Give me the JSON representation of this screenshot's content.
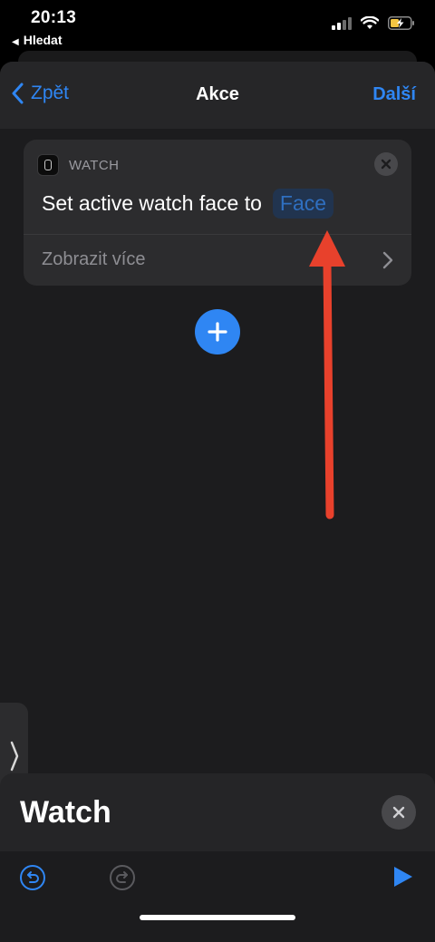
{
  "status": {
    "time": "20:13",
    "back_app": "Hledat"
  },
  "nav": {
    "back_label": "Zpět",
    "title": "Akce",
    "next_label": "Další"
  },
  "card": {
    "app_name": "WATCH",
    "action_text": "Set active watch face to",
    "parameter": "Face",
    "show_more": "Zobrazit více"
  },
  "panel": {
    "title": "Watch"
  },
  "colors": {
    "accent": "#2f86f3",
    "annotation_arrow": "#e8412c",
    "background": "#1c1c1e"
  },
  "icons": [
    "signal-icon",
    "wifi-icon",
    "battery-charging-icon",
    "chevron-left-icon",
    "watch-app-icon",
    "close-icon",
    "chevron-right-icon",
    "plus-icon",
    "undo-icon",
    "redo-icon",
    "play-icon"
  ]
}
